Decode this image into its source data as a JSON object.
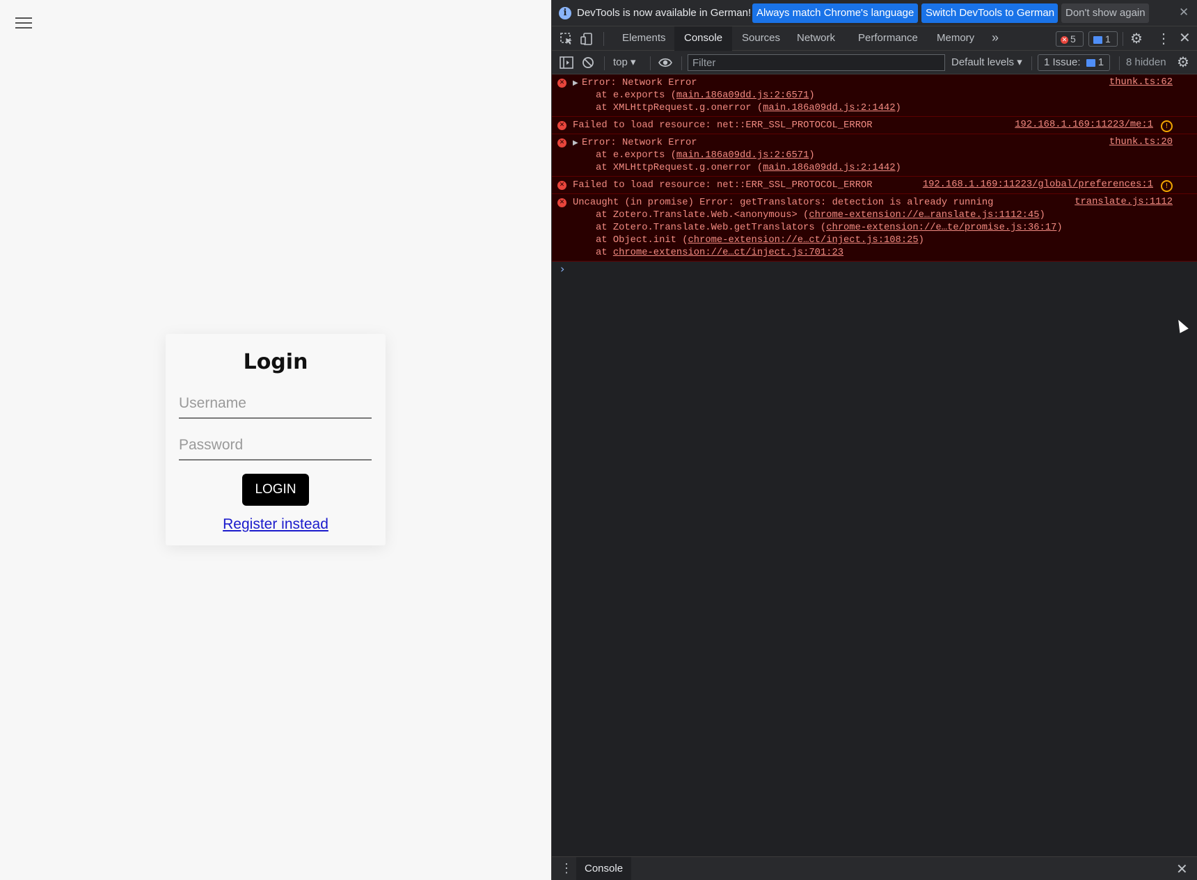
{
  "app": {
    "menu_icon": "hamburger-menu-icon",
    "login": {
      "title": "Login",
      "username_placeholder": "Username",
      "password_placeholder": "Password",
      "username_value": "",
      "password_value": "",
      "login_label": "LOGIN",
      "register_label": "Register instead"
    }
  },
  "devtools": {
    "infobar": {
      "text": "DevTools is now available in German!",
      "match_label": "Always match Chrome's language",
      "switch_label": "Switch DevTools to German",
      "dont_show_label": "Don't show again"
    },
    "tabs": [
      {
        "label": "Elements",
        "active": false
      },
      {
        "label": "Console",
        "active": true
      },
      {
        "label": "Sources",
        "active": false
      },
      {
        "label": "Network",
        "active": false
      },
      {
        "label": "Performance",
        "active": false
      },
      {
        "label": "Memory",
        "active": false
      }
    ],
    "error_count": "5",
    "message_count": "1",
    "toolbar": {
      "context": "top",
      "filter_placeholder": "Filter",
      "filter_value": "",
      "levels": "Default levels",
      "issues_label": "1 Issue:",
      "issues_count": "1",
      "hidden": "8 hidden"
    },
    "messages": [
      {
        "head": "Error: Network Error",
        "source": "thunk.ts:62",
        "stack": [
          {
            "pre": "at e.exports (",
            "link": "main.186a09dd.js:2:6571",
            "post": ")"
          },
          {
            "pre": "at XMLHttpRequest.g.onerror (",
            "link": "main.186a09dd.js:2:1442",
            "post": ")"
          }
        ]
      },
      {
        "head": "Failed to load resource: net::ERR_SSL_PROTOCOL_ERROR",
        "source": "192.168.1.169:11223/me:1"
      },
      {
        "head": "Error: Network Error",
        "source": "thunk.ts:20",
        "stack": [
          {
            "pre": "at e.exports (",
            "link": "main.186a09dd.js:2:6571",
            "post": ")"
          },
          {
            "pre": "at XMLHttpRequest.g.onerror (",
            "link": "main.186a09dd.js:2:1442",
            "post": ")"
          }
        ]
      },
      {
        "head": "Failed to load resource: net::ERR_SSL_PROTOCOL_ERROR",
        "source": "192.168.1.169:11223/global/preferences:1"
      },
      {
        "head": "Uncaught (in promise) Error: getTranslators: detection is already running",
        "source": "translate.js:1112",
        "stack": [
          {
            "pre": "at Zotero.Translate.Web.<anonymous> (",
            "link": "chrome-extension://e…ranslate.js:1112:45",
            "post": ")"
          },
          {
            "pre": "at Zotero.Translate.Web.getTranslators (",
            "link": "chrome-extension://e…te/promise.js:36:17",
            "post": ")"
          },
          {
            "pre": "at Object.init (",
            "link": "chrome-extension://e…ct/inject.js:108:25",
            "post": ")"
          },
          {
            "pre": "at ",
            "link": "chrome-extension://e…ct/inject.js:701:23",
            "post": ""
          }
        ]
      }
    ],
    "drawer": {
      "tab": "Console"
    }
  },
  "colors": {
    "error_text": "#f28b82",
    "error_bg": "#290000",
    "devtools_bg": "#202124",
    "accent_blue": "#1a73e8",
    "link_blue": "#1a1acc"
  }
}
